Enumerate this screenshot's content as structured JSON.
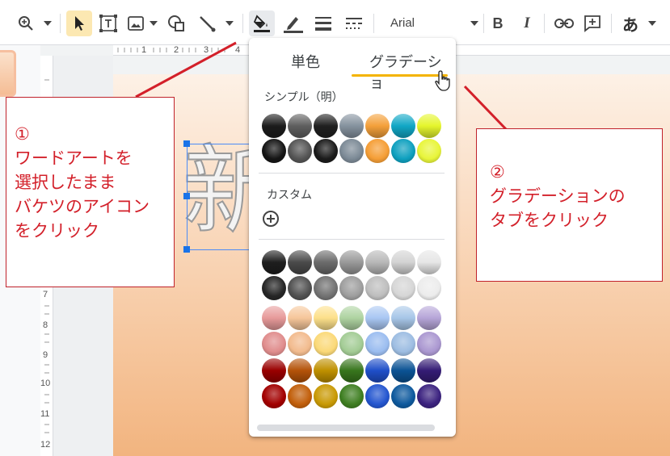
{
  "toolbar": {
    "font_name": "Arial",
    "tools": [
      "zoom-icon",
      "select-icon",
      "textbox-icon",
      "image-icon",
      "shape-icon",
      "line-icon",
      "fill-color-icon",
      "border-color-icon",
      "border-weight-icon",
      "border-dash-icon",
      "bold-icon",
      "italic-icon",
      "link-icon",
      "comment-icon",
      "input-tools-icon"
    ],
    "bold_label": "B",
    "italic_label": "I",
    "input_label": "あ"
  },
  "ruler": {
    "h_marks": [
      "1",
      "2",
      "3",
      "4"
    ],
    "v_marks": [
      "7",
      "8",
      "9",
      "10",
      "11",
      "12"
    ]
  },
  "slide": {
    "wordart_text": "新"
  },
  "callouts": {
    "step1": [
      "①",
      "ワードアートを",
      "選択したまま",
      "バケツのアイコン",
      "をクリック"
    ],
    "step2": [
      "②",
      "グラデーションの",
      "タブをクリック"
    ]
  },
  "popup": {
    "tab_solid": "単色",
    "tab_gradient": "グラデーショ",
    "simple_label": "シンプル（明）",
    "custom_label": "カスタム",
    "colors": {
      "simple_top": [
        "#1c1c1c",
        "#5f5f5f",
        "#202020",
        "#85929e",
        "#f4a03a",
        "#11a7c6",
        "#e5f52c"
      ],
      "simple_bottom": [
        "#151515",
        "#545454",
        "#1b1b1b",
        "#7c8a96",
        "#f59e36",
        "#0ea0bf",
        "#e8f53a"
      ],
      "gray_top": [
        "#1e1e1e",
        "#4a4a4a",
        "#6b6b6b",
        "#999999",
        "#b8b8b8",
        "#d3d3d3",
        "#e6e6e6"
      ],
      "gray_bottom": [
        "#262626",
        "#515151",
        "#737373",
        "#9e9e9e",
        "#bebebe",
        "#d6d6d6",
        "#ececec"
      ],
      "light_top": [
        "#e79a9a",
        "#f6c69a",
        "#fde08a",
        "#aed3a1",
        "#a9c7f3",
        "#a7c6e8",
        "#b6a5d8"
      ],
      "light_bottom": [
        "#e08d8d",
        "#f2bb8e",
        "#fbd978",
        "#a3cc95",
        "#9bbdf0",
        "#9dbde2",
        "#ab98d1"
      ],
      "dark_top": [
        "#990000",
        "#b45309",
        "#bf9000",
        "#38761d",
        "#1f4fc9",
        "#0b5394",
        "#351c75"
      ],
      "dark_bottom": [
        "#a30000",
        "#c25f0b",
        "#c99a05",
        "#3f7f22",
        "#2456d0",
        "#0f5a9e",
        "#3c2380"
      ]
    }
  },
  "annotation_color": "#d3202a"
}
